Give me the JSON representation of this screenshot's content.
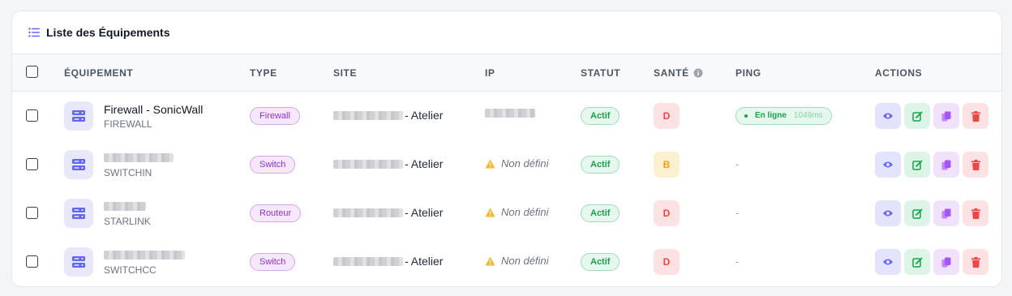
{
  "card": {
    "title": "Liste des Équipements",
    "title_icon": "list-icon"
  },
  "table": {
    "headers": {
      "equipment": "ÉQUIPEMENT",
      "type": "TYPE",
      "site": "SITE",
      "ip": "IP",
      "status": "STATUT",
      "health": "SANTÉ",
      "ping": "PING",
      "actions": "ACTIONS"
    },
    "rows": [
      {
        "name": "Firewall - SonicWall",
        "sub": "FIREWALL",
        "type": "Firewall",
        "site_suffix": "- Atelier",
        "ip": "",
        "status": "Actif",
        "health": "D",
        "ping_status": "En ligne",
        "ping_ms": "1049ms"
      },
      {
        "name": "",
        "sub": "SWITCHIN",
        "type": "Switch",
        "site_suffix": "- Atelier",
        "ip": "Non défini",
        "status": "Actif",
        "health": "B",
        "ping_status": "-",
        "ping_ms": ""
      },
      {
        "name": "",
        "sub": "STARLINK",
        "type": "Routeur",
        "site_suffix": "- Atelier",
        "ip": "Non défini",
        "status": "Actif",
        "health": "D",
        "ping_status": "-",
        "ping_ms": ""
      },
      {
        "name": "",
        "sub": "SWITCHCC",
        "type": "Switch",
        "site_suffix": "- Atelier",
        "ip": "Non défini",
        "status": "Actif",
        "health": "D",
        "ping_status": "-",
        "ping_ms": ""
      }
    ]
  },
  "colors": {
    "accent": "#6366f1",
    "badge_purple": "#9333c9",
    "status_green": "#16a34a",
    "health_d": "#ef4444",
    "health_b": "#f59e0b",
    "warning": "#f5b731"
  },
  "icons": {
    "equipment": "server-icon",
    "warning": "warning-icon",
    "info": "info-icon",
    "view": "eye-icon",
    "edit": "edit-icon",
    "copy": "copy-icon",
    "delete": "trash-icon"
  }
}
